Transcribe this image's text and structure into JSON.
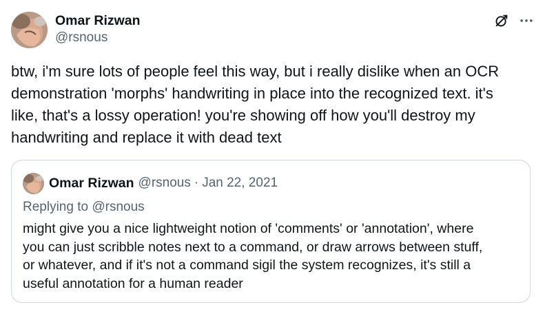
{
  "tweet": {
    "author": {
      "display_name": "Omar Rizwan",
      "handle": "@rsnous",
      "avatar_icon": "profile-photo"
    },
    "actions": {
      "grok_icon": "grok-icon",
      "more_icon": "more-horizontal-icon"
    },
    "text": "btw, i'm sure lots of people feel this way, but i really dislike when an OCR\ndemonstration 'morphs' handwriting in place into the recognized text. it's\nlike, that's a lossy operation! you're showing off how you'll destroy my\nhandwriting and replace it with dead text"
  },
  "quoted_tweet": {
    "author": {
      "display_name": "Omar Rizwan",
      "handle": "@rsnous"
    },
    "separator": "·",
    "date": "Jan 22, 2021",
    "replying_to": "Replying to @rsnous",
    "text": "might give you a nice lightweight notion of 'comments' or 'annotation', where\nyou can just scribble notes next to a command, or draw arrows between stuff,\nor whatever, and if it's not a command sigil the system recognizes, it's still a\nuseful annotation for a human reader"
  },
  "colors": {
    "text_primary": "#0f1419",
    "text_secondary": "#536471",
    "border": "#cfd9de",
    "background": "#ffffff"
  }
}
